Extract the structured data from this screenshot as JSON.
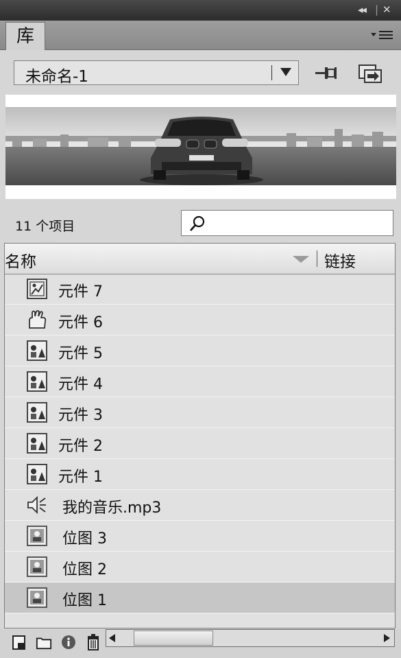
{
  "panel": {
    "tab_label": "库"
  },
  "document_selector": {
    "selected": "未命名-1"
  },
  "item_count_text": "11 个项目",
  "search": {
    "placeholder": ""
  },
  "columns": {
    "name": "名称",
    "linkage": "链接"
  },
  "items": [
    {
      "label": "元件 7",
      "icon": "movieclip-icon"
    },
    {
      "label": "元件 6",
      "icon": "button-symbol-icon"
    },
    {
      "label": "元件 5",
      "icon": "graphic-symbol-icon"
    },
    {
      "label": "元件 4",
      "icon": "graphic-symbol-icon"
    },
    {
      "label": "元件 3",
      "icon": "graphic-symbol-icon"
    },
    {
      "label": "元件 2",
      "icon": "graphic-symbol-icon"
    },
    {
      "label": "元件 1",
      "icon": "graphic-symbol-icon"
    },
    {
      "label": "我的音乐.mp3",
      "icon": "sound-icon"
    },
    {
      "label": "位图 3",
      "icon": "bitmap-icon"
    },
    {
      "label": "位图 2",
      "icon": "bitmap-icon"
    },
    {
      "label": "位图 1",
      "icon": "bitmap-icon",
      "selected": true
    }
  ]
}
